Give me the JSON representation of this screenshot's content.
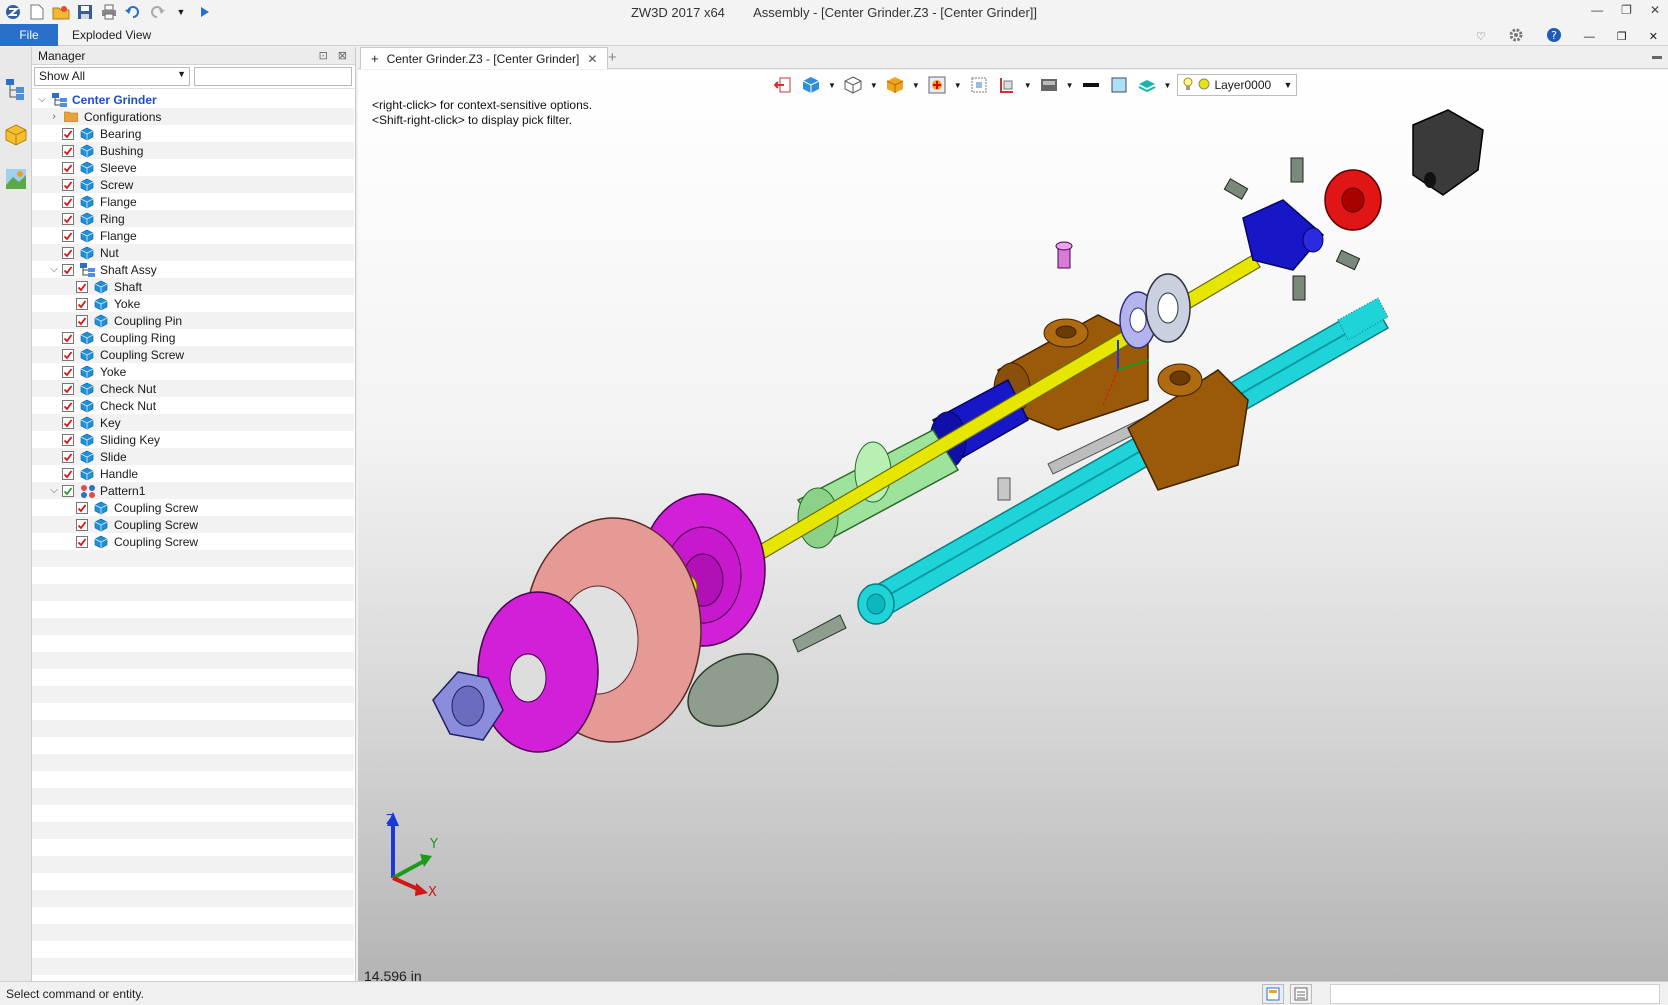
{
  "window": {
    "app_title": "ZW3D 2017  x64",
    "doc_title": "Assembly - [Center Grinder.Z3 - [Center Grinder]]"
  },
  "menu": {
    "file_label": "File",
    "exploded_view_label": "Exploded View"
  },
  "manager": {
    "title": "Manager",
    "filter_value": "Show All",
    "search_value": ""
  },
  "tree": {
    "root": "Center Grinder",
    "configurations": "Configurations",
    "items": [
      {
        "label": "Bearing",
        "level": 1,
        "type": "part"
      },
      {
        "label": "Bushing",
        "level": 1,
        "type": "part"
      },
      {
        "label": "Sleeve",
        "level": 1,
        "type": "part"
      },
      {
        "label": "Screw",
        "level": 1,
        "type": "part"
      },
      {
        "label": "Flange",
        "level": 1,
        "type": "part"
      },
      {
        "label": "Ring",
        "level": 1,
        "type": "part"
      },
      {
        "label": "Flange",
        "level": 1,
        "type": "part"
      },
      {
        "label": "Nut",
        "level": 1,
        "type": "part"
      },
      {
        "label": "Shaft Assy",
        "level": 1,
        "type": "assembly",
        "expanded": true
      },
      {
        "label": "Shaft",
        "level": 2,
        "type": "part"
      },
      {
        "label": "Yoke",
        "level": 2,
        "type": "part"
      },
      {
        "label": "Coupling Pin",
        "level": 2,
        "type": "part"
      },
      {
        "label": "Coupling Ring",
        "level": 1,
        "type": "part"
      },
      {
        "label": "Coupling Screw",
        "level": 1,
        "type": "part"
      },
      {
        "label": "Yoke",
        "level": 1,
        "type": "part"
      },
      {
        "label": "Check Nut",
        "level": 1,
        "type": "part"
      },
      {
        "label": "Check Nut",
        "level": 1,
        "type": "part"
      },
      {
        "label": "Key",
        "level": 1,
        "type": "part"
      },
      {
        "label": "Sliding Key",
        "level": 1,
        "type": "part"
      },
      {
        "label": "Slide",
        "level": 1,
        "type": "part"
      },
      {
        "label": "Handle",
        "level": 1,
        "type": "part"
      },
      {
        "label": "Pattern1",
        "level": 1,
        "type": "pattern",
        "expanded": true
      },
      {
        "label": "Coupling Screw",
        "level": 2,
        "type": "part"
      },
      {
        "label": "Coupling Screw",
        "level": 2,
        "type": "part"
      },
      {
        "label": "Coupling Screw",
        "level": 2,
        "type": "part"
      }
    ]
  },
  "doc_tab": {
    "label": "Center Grinder.Z3 - [Center Grinder]"
  },
  "viewport": {
    "layer": "Layer0000",
    "hint_line1": "<right-click> for context-sensitive options.",
    "hint_line2": "<Shift-right-click> to display pick filter.",
    "scale": "14.596 in",
    "triad": {
      "z": "Z",
      "y": "Y",
      "x": "X"
    }
  },
  "status": {
    "message": "Select command or entity."
  },
  "colors": {
    "accent": "#2a6fc9",
    "brown": "#9a5a0a",
    "magenta": "#d21fd8",
    "pink": "#e69a96",
    "cyan": "#1ed4d9",
    "blue": "#1717c8",
    "green": "#9ee39b",
    "yellow": "#e6e600",
    "red": "#e01515",
    "gray": "#8e9d8e",
    "lavender": "#8c8cdc"
  }
}
